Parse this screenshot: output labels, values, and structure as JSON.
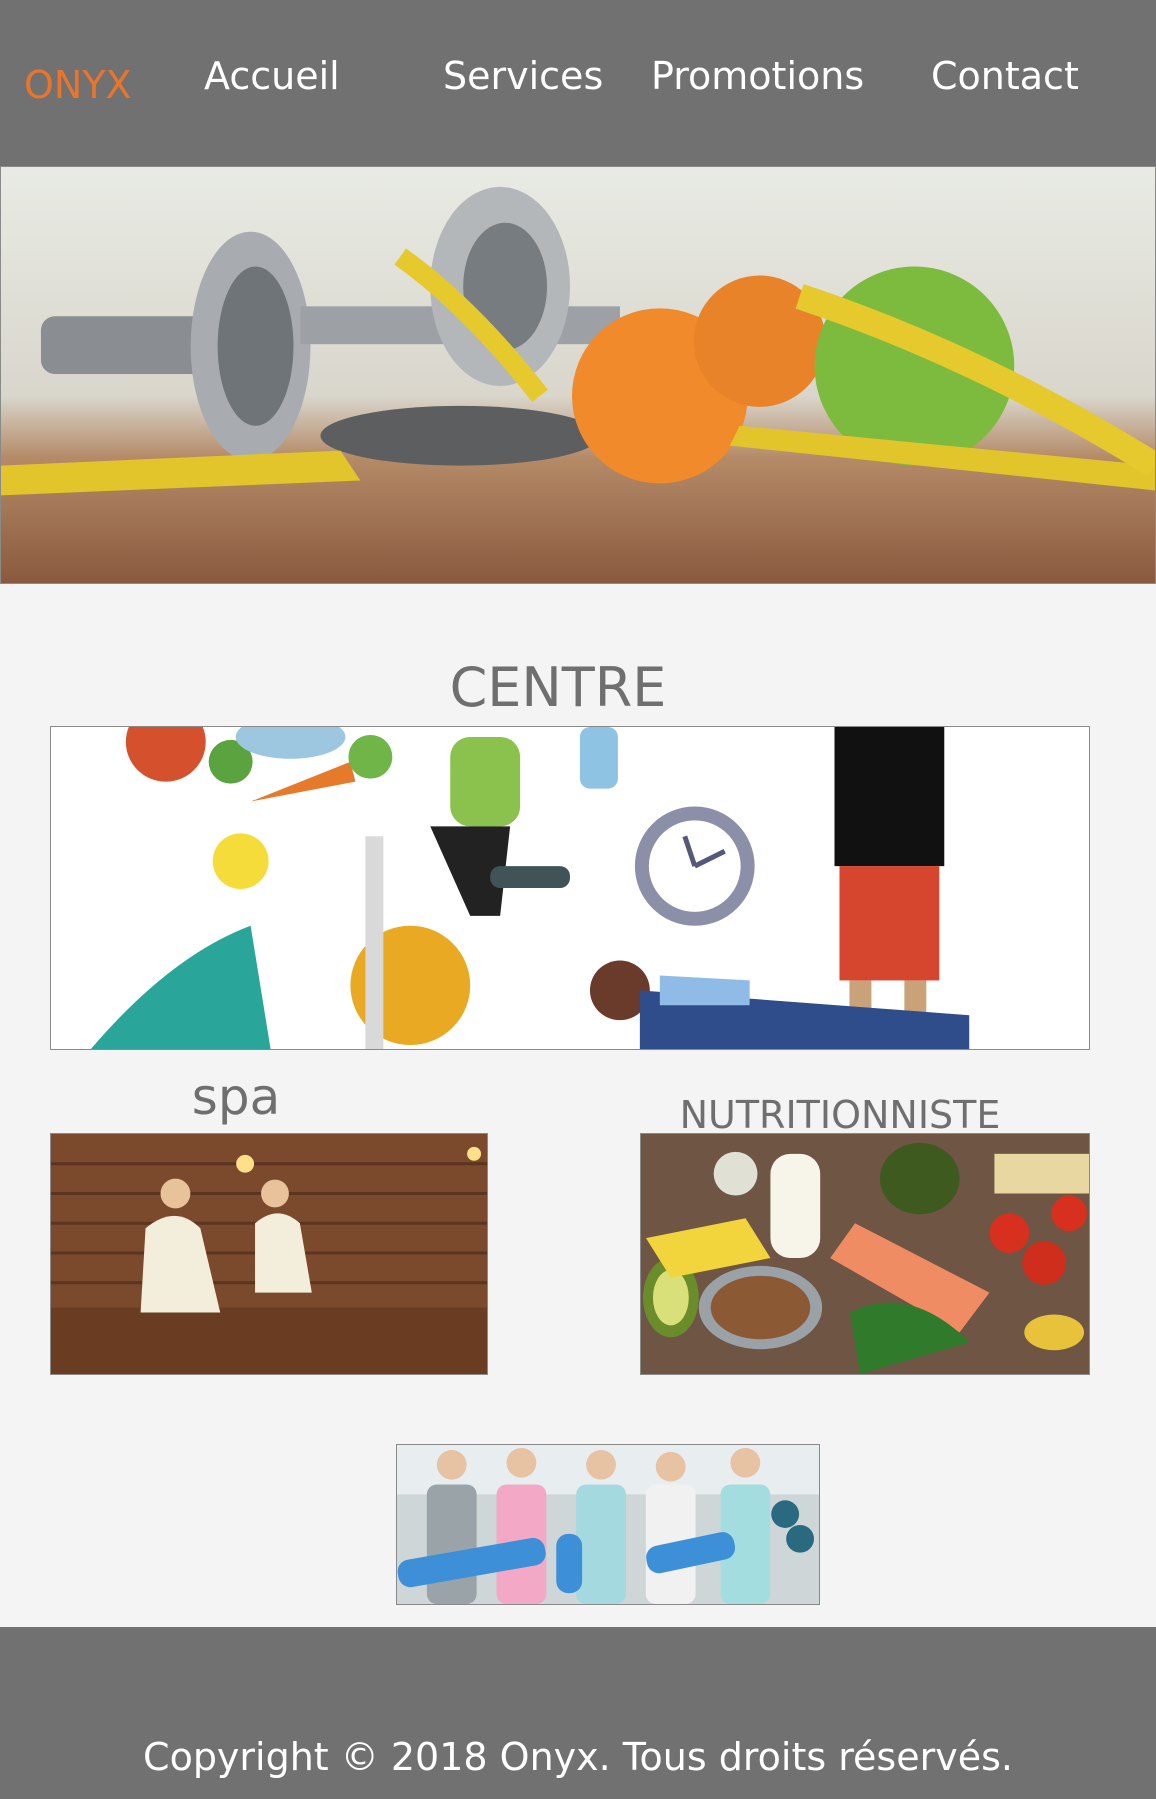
{
  "header": {
    "logo": "ONYX",
    "nav": {
      "accueil": "Accueil",
      "services": "Services",
      "promotions": "Promotions",
      "contact": "Contact"
    }
  },
  "sections": {
    "centre_title": "CENTRE",
    "spa_title": "spa",
    "nutrition_title": "NUTRITIONNISTE"
  },
  "footer": {
    "copyright": "Copyright © 2018 Onyx. Tous droits réservés."
  },
  "colors": {
    "header_bg": "#717171",
    "logo": "#e9752c",
    "page_bg": "#f4f4f4",
    "section_title": "#6f6f6f"
  }
}
